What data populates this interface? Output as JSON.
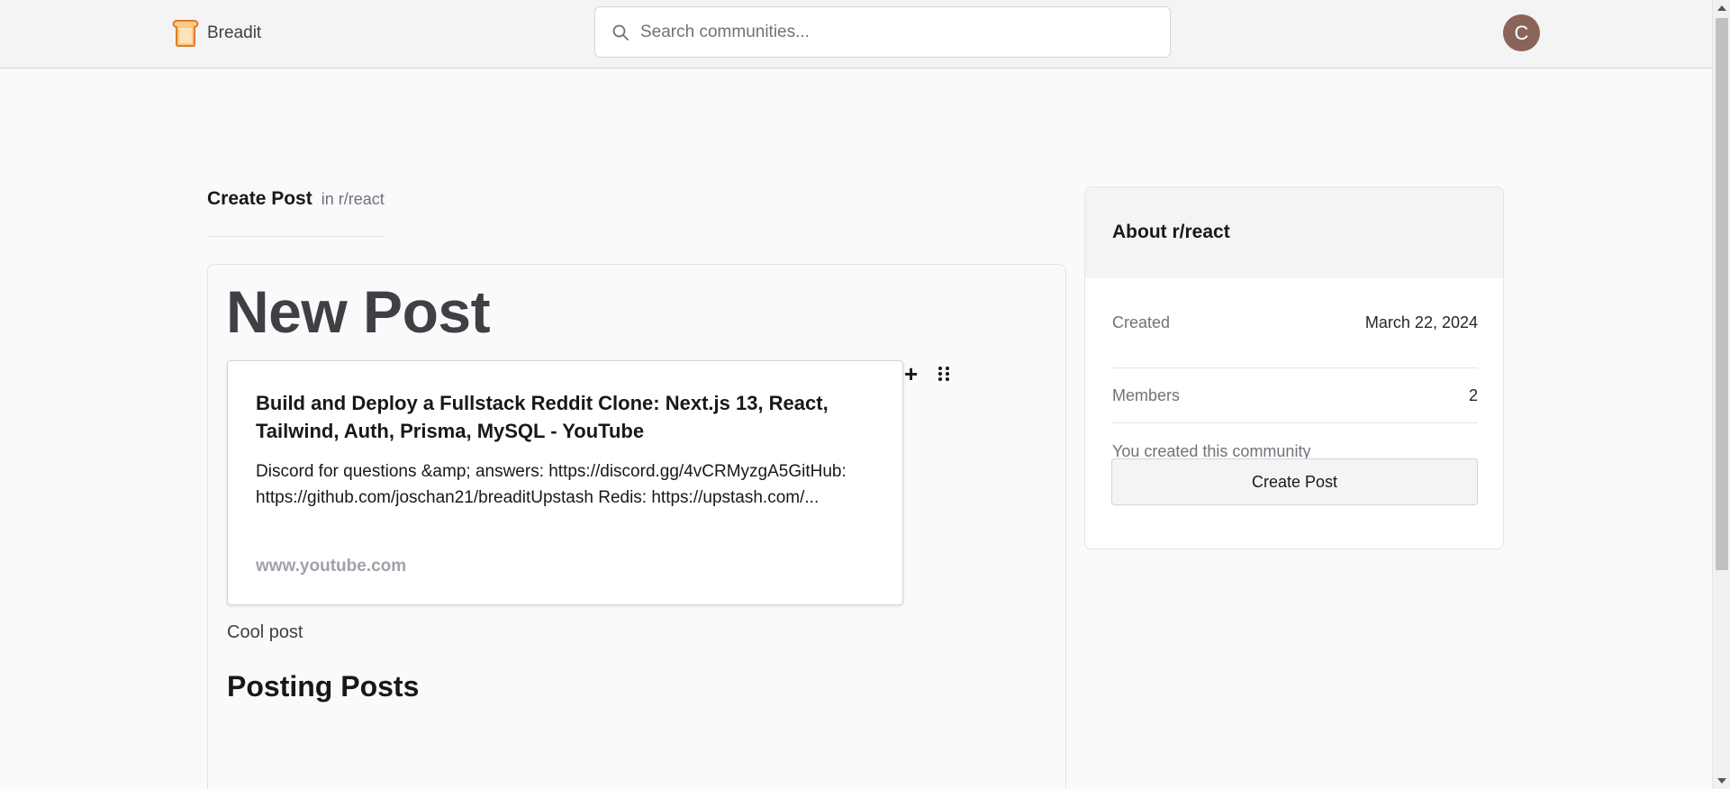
{
  "navbar": {
    "brand": "Breadit",
    "search_placeholder": "Search communities...",
    "avatar_initial": "C",
    "avatar_color": "#8b6459"
  },
  "page": {
    "heading_title": "Create Post",
    "heading_sub": "in r/react"
  },
  "editor": {
    "title": "New Post",
    "link_card": {
      "title": "Build and Deploy a Fullstack Reddit Clone: Next.js 13, React, Tailwind, Auth, Prisma, MySQL - YouTube",
      "description": "Discord for questions &amp; answers: https://discord.gg/4vCRMyzgA5GitHub: https://github.com/joschan21/breaditUpstash Redis: https://upstash.com/...",
      "domain": "www.youtube.com"
    },
    "paragraph": "Cool post",
    "heading2": "Posting Posts"
  },
  "sidebar": {
    "title": "About r/react",
    "created_label": "Created",
    "created_value": "March 22, 2024",
    "members_label": "Members",
    "members_value": "2",
    "note": "You created this community",
    "create_button": "Create Post"
  },
  "icons": {
    "logo": "bread-logo-icon",
    "search": "search-icon",
    "add_block": "plus-icon",
    "drag": "drag-handle-icon"
  }
}
